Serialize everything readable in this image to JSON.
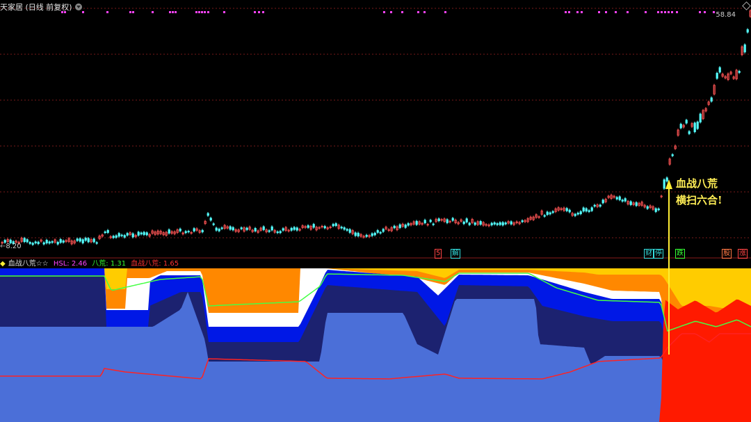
{
  "header": {
    "title": "天家居 (日线 前复权)"
  },
  "price_axis": {
    "high_label": "58.84",
    "low_label": "8.20"
  },
  "annotation": {
    "line1": "血战八荒",
    "line2": "横扫六合!"
  },
  "indicator": {
    "name": "血战八荒☆☆",
    "hsl_label": "HSL: 2.46",
    "bahuang_label": "八荒: 1.31",
    "xuezhan_label": "血战八荒: 1.65",
    "colors": {
      "hsl": "#ff44ff",
      "bahuang": "#33ff33",
      "xuezhan": "#ff3333",
      "name": "#e0e0e0"
    }
  },
  "event_badges": [
    {
      "label": "5",
      "color": "#ff4444"
    },
    {
      "label": "解",
      "color": "#33dddd"
    },
    {
      "label": "财",
      "color": "#33dddd"
    },
    {
      "label": "停",
      "color": "#33dddd"
    },
    {
      "label": "跌",
      "color": "#33ff33"
    },
    {
      "label": "股",
      "color": "#ff7744"
    },
    {
      "label": "涨",
      "color": "#ff4444"
    }
  ],
  "colors": {
    "background": "#000000",
    "grid": "#7a1a1a",
    "candle_up": "#ff5555",
    "candle_down": "#55ffff",
    "signal_dots": "#ff44ff",
    "arrow": "#ffee33",
    "zone_light_blue": "#4b6fd8",
    "zone_navy": "#1c2270",
    "zone_blue": "#0018e6",
    "zone_yellow": "#ffcc00",
    "zone_white": "#ffffff",
    "zone_red": "#ff1a00",
    "zone_orange": "#ff8800",
    "line_green": "#44ff44",
    "line_red": "#ff2222"
  }
}
